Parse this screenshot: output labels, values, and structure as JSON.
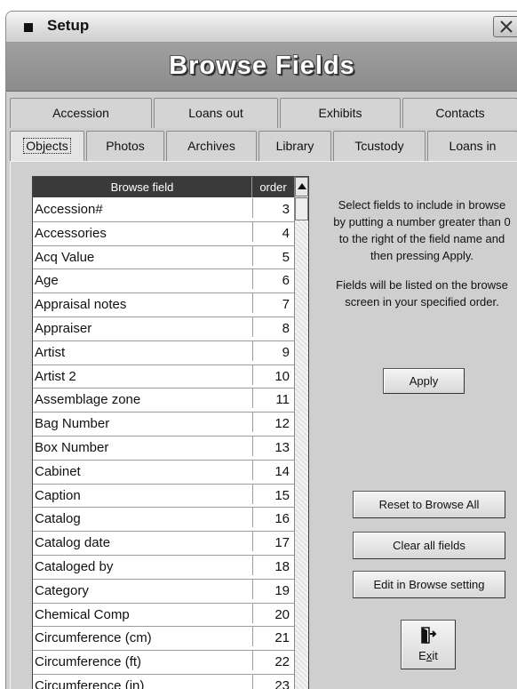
{
  "window": {
    "title": "Setup",
    "heading": "Browse Fields"
  },
  "tabs_row1": [
    "Accession",
    "Loans out",
    "Exhibits",
    "Contacts"
  ],
  "tabs_row2": [
    "Objects",
    "Photos",
    "Archives",
    "Library",
    "Tcustody",
    "Loans in"
  ],
  "active_tab": "Objects",
  "grid": {
    "col_field": "Browse field",
    "col_order": "order",
    "rows": [
      {
        "field": "Accession#",
        "order": "3"
      },
      {
        "field": "Accessories",
        "order": "4"
      },
      {
        "field": "Acq Value",
        "order": "5"
      },
      {
        "field": "Age",
        "order": "6"
      },
      {
        "field": "Appraisal notes",
        "order": "7"
      },
      {
        "field": "Appraiser",
        "order": "8"
      },
      {
        "field": "Artist",
        "order": "9"
      },
      {
        "field": "Artist 2",
        "order": "10"
      },
      {
        "field": "Assemblage zone",
        "order": "11"
      },
      {
        "field": "Bag Number",
        "order": "12"
      },
      {
        "field": "Box Number",
        "order": "13"
      },
      {
        "field": "Cabinet",
        "order": "14"
      },
      {
        "field": "Caption",
        "order": "15"
      },
      {
        "field": "Catalog",
        "order": "16"
      },
      {
        "field": "Catalog date",
        "order": "17"
      },
      {
        "field": "Cataloged by",
        "order": "18"
      },
      {
        "field": "Category",
        "order": "19"
      },
      {
        "field": "Chemical Comp",
        "order": "20"
      },
      {
        "field": "Circumference (cm)",
        "order": "21"
      },
      {
        "field": "Circumference (ft)",
        "order": "22"
      },
      {
        "field": "Circumference (in)",
        "order": "23"
      }
    ]
  },
  "instructions": {
    "p1": "Select fields to include in browse by putting a number greater than 0 to the right of the field name and then pressing Apply.",
    "p2": "Fields will be listed on the browse screen in your specified order."
  },
  "buttons": {
    "apply": "Apply",
    "reset": "Reset to Browse All",
    "clear": "Clear all fields",
    "edit": "Edit in Browse setting",
    "exit_prefix": "E",
    "exit_underlined": "x",
    "exit_suffix": "it"
  },
  "icons": {
    "window": "square-icon",
    "close": "close-icon",
    "exit": "exit-door-icon",
    "scroll_up": "arrow-up-icon"
  }
}
